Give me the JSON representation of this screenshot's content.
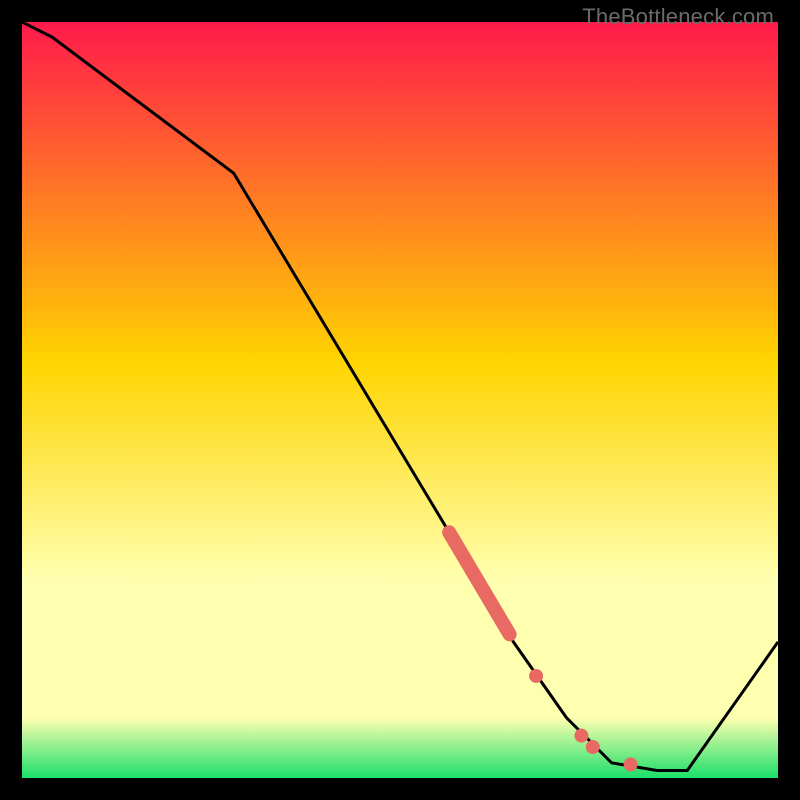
{
  "watermark": "TheBottleneck.com",
  "colors": {
    "top": "#ff1a4b",
    "mid": "#ffd400",
    "pale": "#ffffb0",
    "green": "#1bdf6a",
    "line": "#000000",
    "dot": "#e96a62"
  },
  "chart_data": {
    "type": "line",
    "title": "",
    "xlabel": "",
    "ylabel": "",
    "xlim": [
      0,
      100
    ],
    "ylim": [
      0,
      100
    ],
    "series": [
      {
        "name": "bottleneck-curve",
        "x": [
          0,
          4,
          28,
          58,
          65,
          72,
          78,
          84,
          88,
          100
        ],
        "y": [
          100,
          98,
          80,
          30,
          18,
          8,
          2,
          1,
          1,
          18
        ]
      }
    ],
    "highlight_segment": {
      "name": "red-thick-range",
      "x": [
        56.5,
        64.5
      ],
      "y": [
        32.5,
        19
      ]
    },
    "highlight_points": [
      {
        "x": 68,
        "y": 13.5
      },
      {
        "x": 74,
        "y": 5.6
      },
      {
        "x": 75.5,
        "y": 4.1
      },
      {
        "x": 80.5,
        "y": 1.8
      }
    ],
    "gradient_stops_percent": [
      {
        "pct": 0,
        "color": "top"
      },
      {
        "pct": 45,
        "color": "mid"
      },
      {
        "pct": 74,
        "color": "pale"
      },
      {
        "pct": 92,
        "color": "pale"
      },
      {
        "pct": 100,
        "color": "green"
      }
    ]
  }
}
